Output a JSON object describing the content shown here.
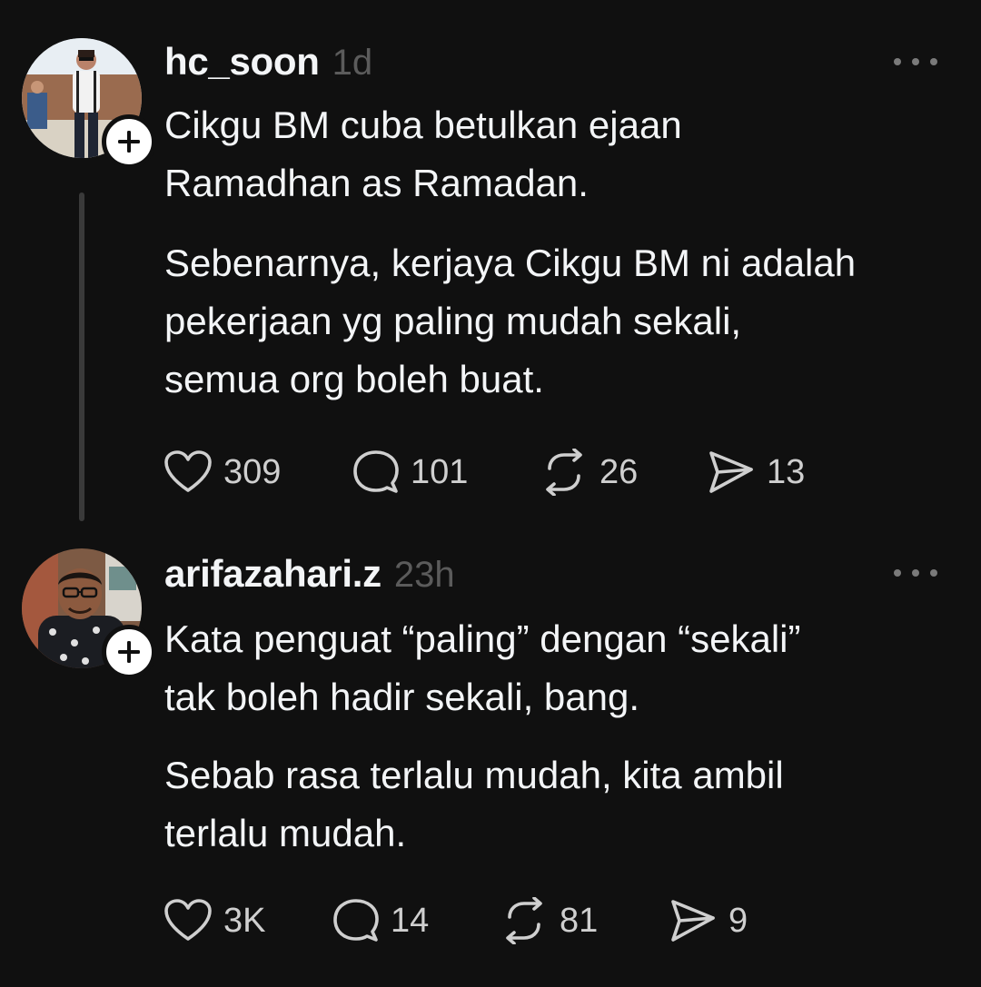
{
  "posts": [
    {
      "username": "hc_soon",
      "timestamp": "1d",
      "paragraphs": [
        [
          "Cikgu BM cuba betulkan ejaan",
          "Ramadhan as Ramadan."
        ],
        [
          "Sebenarnya, kerjaya Cikgu BM ni adalah",
          "pekerjaan yg paling mudah sekali,",
          "semua org boleh buat."
        ]
      ],
      "likes": "309",
      "replies": "101",
      "reposts": "26",
      "shares": "13"
    },
    {
      "username": "arifazahari.z",
      "timestamp": "23h",
      "paragraphs": [
        [
          "Kata penguat “paling” dengan “sekali”",
          "tak boleh hadir sekali, bang."
        ],
        [
          "Sebab rasa terlalu mudah, kita ambil",
          "terlalu mudah."
        ]
      ],
      "likes": "3K",
      "replies": "14",
      "reposts": "81",
      "shares": "9"
    }
  ],
  "icons": {
    "like": "heart-icon",
    "reply": "comment-icon",
    "repost": "repost-icon",
    "share": "send-icon",
    "more": "more-dots-icon",
    "follow": "plus-icon"
  },
  "colors": {
    "background": "#101010",
    "text": "#f3f5f7",
    "muted": "#5b5b5b",
    "icon": "#cfcfcf"
  }
}
